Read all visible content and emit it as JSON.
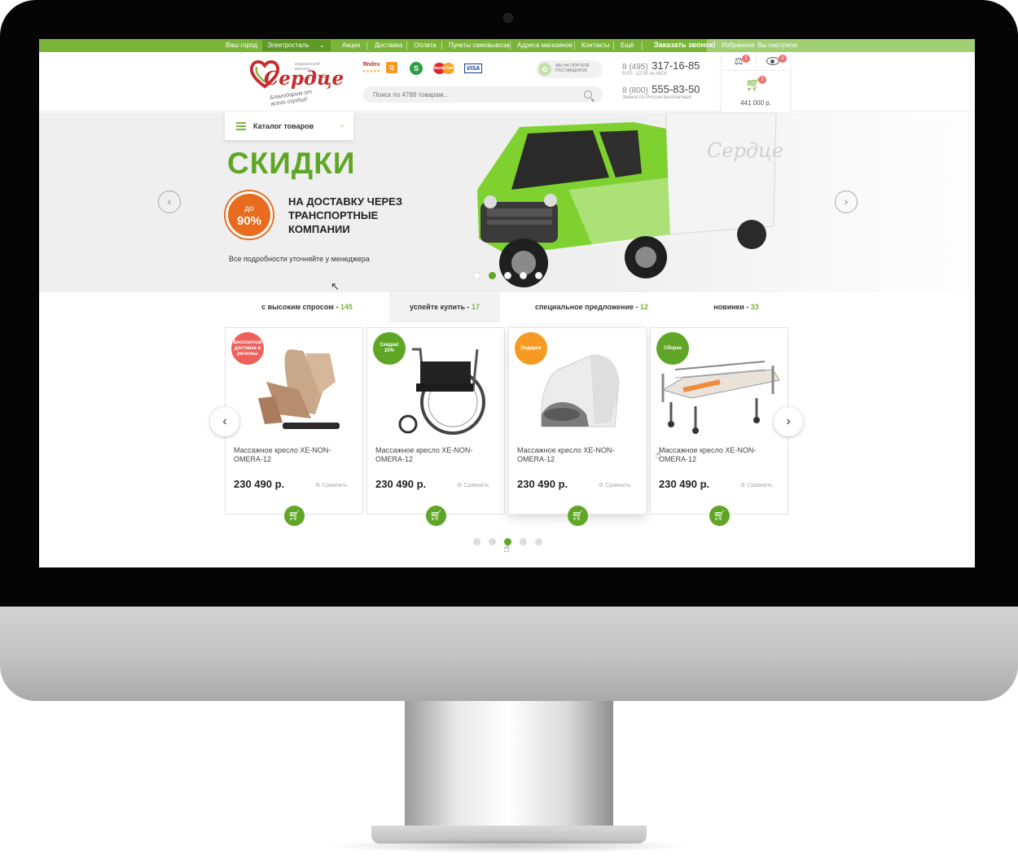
{
  "topbar": {
    "city_label": "Ваш город",
    "city_value": "Электросталь",
    "nav": [
      "Акции",
      "Доставка",
      "Оплата",
      "Пункты самовывоза",
      "Адреса магазинов",
      "Контакты",
      "Ещё"
    ],
    "callback": "Заказать звонок!",
    "favorites": "Избранное",
    "viewed": "Вы смотрели"
  },
  "logo": {
    "word": "Сердце",
    "reg": "®",
    "slogan": "Благодарим от всего сердца!",
    "tiny": "медицинский магазин"
  },
  "payments": {
    "yandex": "Яndex",
    "yandex_stars": "★★★★★",
    "qiwi": "Q",
    "sber": "S",
    "mastercard": "MasterCard",
    "visa": "VISA"
  },
  "search": {
    "placeholder": "Поиск по 4788 товарам..."
  },
  "supplier": {
    "text": "МЫ НА ПОРТАЛЕ ПОСТАВЩИКОВ",
    "icon": "supplier-icon"
  },
  "phones": [
    {
      "code": "8 (495)",
      "number": "317-16-85",
      "note": "9:00 - 22:00 по МСК"
    },
    {
      "code": "8 (800)",
      "number": "555-83-50",
      "note": "Звонок по России Бесплатный"
    }
  ],
  "user_panel": {
    "compare_count": "1",
    "viewed_count": "1",
    "cart_count": "1",
    "cart_total": "441 000 р."
  },
  "catalog": {
    "label": "Каталог товаров"
  },
  "hero": {
    "title": "СКИДКИ",
    "discount_prefix": "до",
    "discount_value": "90%",
    "subtitle": "НА ДОСТАВКУ ЧЕРЕЗ ТРАНСПОРТНЫЕ КОМПАНИИ",
    "note": "Все подробности уточняйте у менеджера",
    "truck_brand": "Сердце",
    "slides_total": 5,
    "slide_active": 2
  },
  "tabs": [
    {
      "label": "с высоким спросом - ",
      "count": "145"
    },
    {
      "label": "успейте купить - ",
      "count": "17"
    },
    {
      "label": "специальное предложение - ",
      "count": "12"
    },
    {
      "label": "новинки - ",
      "count": "33"
    }
  ],
  "products": [
    {
      "tag": "Бесплатная доставка в регионы",
      "tag_color": "#f0605a",
      "name": "Массажное кресло XE-NON-OMERA-12",
      "price": "230 490 р.",
      "compare": "Сравнить"
    },
    {
      "tag": "Скидка! 20%",
      "tag_color": "#5fa626",
      "name": "Массажное кресло XE-NON-OMERA-12",
      "price": "230 490 р.",
      "compare": "Сравнить"
    },
    {
      "tag": "Подарок",
      "tag_color": "#f59a23",
      "name": "Массажное кресло XE-NON-OMERA-12",
      "price": "230 490 р.",
      "compare": "Сравнить"
    },
    {
      "tag": "Сборка",
      "tag_color": "#5fa626",
      "name": "Массажное кресло XE-NON-OMERA-12",
      "price": "230 490 р.",
      "compare": "Сравнить"
    }
  ],
  "products_pager": {
    "total": 5,
    "active": 3
  },
  "colors": {
    "green": "#7ab53a",
    "dark_green": "#5fa626",
    "orange": "#e96b1e",
    "red": "#f0605a"
  }
}
